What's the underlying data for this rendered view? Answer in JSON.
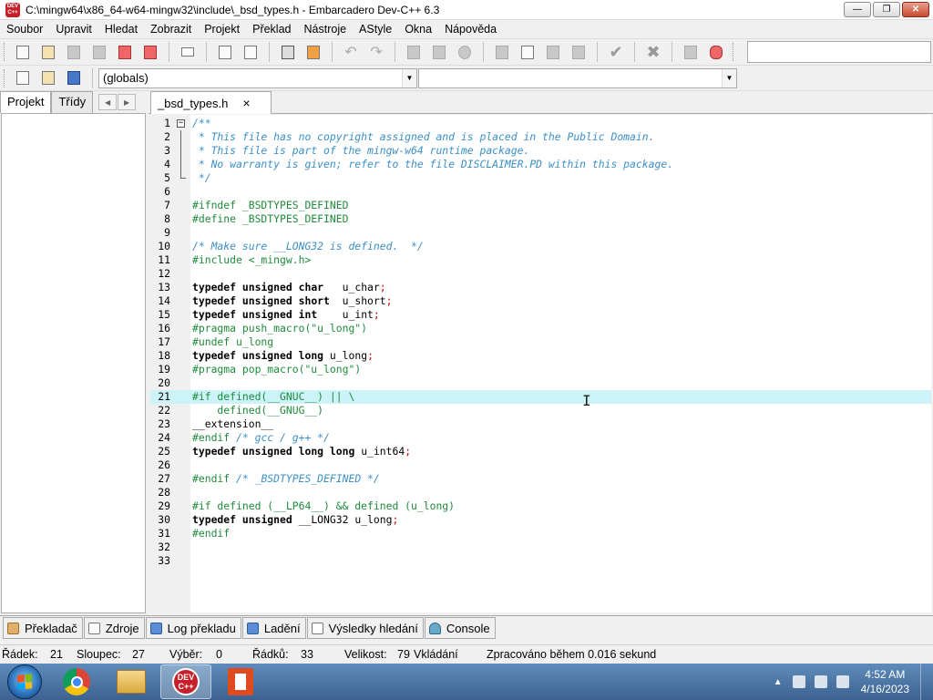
{
  "window": {
    "title": "C:\\mingw64\\x86_64-w64-mingw32\\include\\_bsd_types.h - Embarcadero Dev-C++ 6.3",
    "app_icon_text": "DEV C++"
  },
  "menu": [
    "Soubor",
    "Upravit",
    "Hledat",
    "Zobrazit",
    "Projekt",
    "Překlad",
    "Nástroje",
    "AStyle",
    "Okna",
    "Nápověda"
  ],
  "toolbar2": {
    "scope_combo": "(globals)",
    "member_combo": ""
  },
  "left_panel": {
    "tabs": [
      "Projekt",
      "Třídy"
    ],
    "active_tab": "Projekt"
  },
  "editor": {
    "tab_label": "_bsd_types.h",
    "tab_close": "×",
    "highlighted_line": 21,
    "lines": [
      {
        "n": "1",
        "t": "/**"
      },
      {
        "n": "2",
        "t": " * This file has no copyright assigned and is placed in the Public Domain."
      },
      {
        "n": "3",
        "t": " * This file is part of the mingw-w64 runtime package."
      },
      {
        "n": "4",
        "t": " * No warranty is given; refer to the file DISCLAIMER.PD within this package."
      },
      {
        "n": "5",
        "t": " */"
      },
      {
        "n": "6",
        "t": ""
      },
      {
        "n": "7",
        "t": "#ifndef _BSDTYPES_DEFINED"
      },
      {
        "n": "8",
        "t": "#define _BSDTYPES_DEFINED"
      },
      {
        "n": "9",
        "t": ""
      },
      {
        "n": "10",
        "t": "/* Make sure __LONG32 is defined.  */"
      },
      {
        "n": "11",
        "t": "#include <_mingw.h>"
      },
      {
        "n": "12",
        "t": ""
      },
      {
        "n": "13",
        "t": "typedef unsigned char   u_char;"
      },
      {
        "n": "14",
        "t": "typedef unsigned short  u_short;"
      },
      {
        "n": "15",
        "t": "typedef unsigned int    u_int;"
      },
      {
        "n": "16",
        "t": "#pragma push_macro(\"u_long\")"
      },
      {
        "n": "17",
        "t": "#undef u_long"
      },
      {
        "n": "18",
        "t": "typedef unsigned long u_long;"
      },
      {
        "n": "19",
        "t": "#pragma pop_macro(\"u_long\")"
      },
      {
        "n": "20",
        "t": ""
      },
      {
        "n": "21",
        "t": "#if defined(__GNUC__) || \\"
      },
      {
        "n": "22",
        "t": "    defined(__GNUG__)"
      },
      {
        "n": "23",
        "t": "__extension__"
      },
      {
        "n": "24",
        "t": "#endif /* gcc / g++ */"
      },
      {
        "n": "25",
        "t": "typedef unsigned long long u_int64;"
      },
      {
        "n": "26",
        "t": ""
      },
      {
        "n": "27",
        "t": "#endif /* _BSDTYPES_DEFINED */"
      },
      {
        "n": "28",
        "t": ""
      },
      {
        "n": "29",
        "t": "#if defined (__LP64__) && defined (u_long)"
      },
      {
        "n": "30",
        "t": "typedef unsigned __LONG32 u_long;"
      },
      {
        "n": "31",
        "t": "#endif"
      },
      {
        "n": "32",
        "t": ""
      },
      {
        "n": "33",
        "t": ""
      }
    ]
  },
  "bottom_tabs": [
    "Překladač",
    "Zdroje",
    "Log překladu",
    "Ladění",
    "Výsledky hledání",
    "Console"
  ],
  "status": {
    "line_label": "Řádek:",
    "line_value": "21",
    "col_label": "Sloupec:",
    "col_value": "27",
    "sel_label": "Výběr:",
    "sel_value": "0",
    "lines_label": "Řádků:",
    "lines_value": "33",
    "size_label": "Velikost:",
    "size_value": "79",
    "mode": "Vkládání",
    "parse_info": "Zpracováno během 0.016 sekund"
  },
  "taskbar": {
    "devcpp_label": "DEV C++",
    "time": "4:52 AM",
    "date": "4/16/2023"
  },
  "colors": {
    "comment": "#3b8fc8",
    "preprocessor": "#1f8a3b",
    "operator": "#cc0000",
    "line_highlight": "#ccf4f8"
  }
}
